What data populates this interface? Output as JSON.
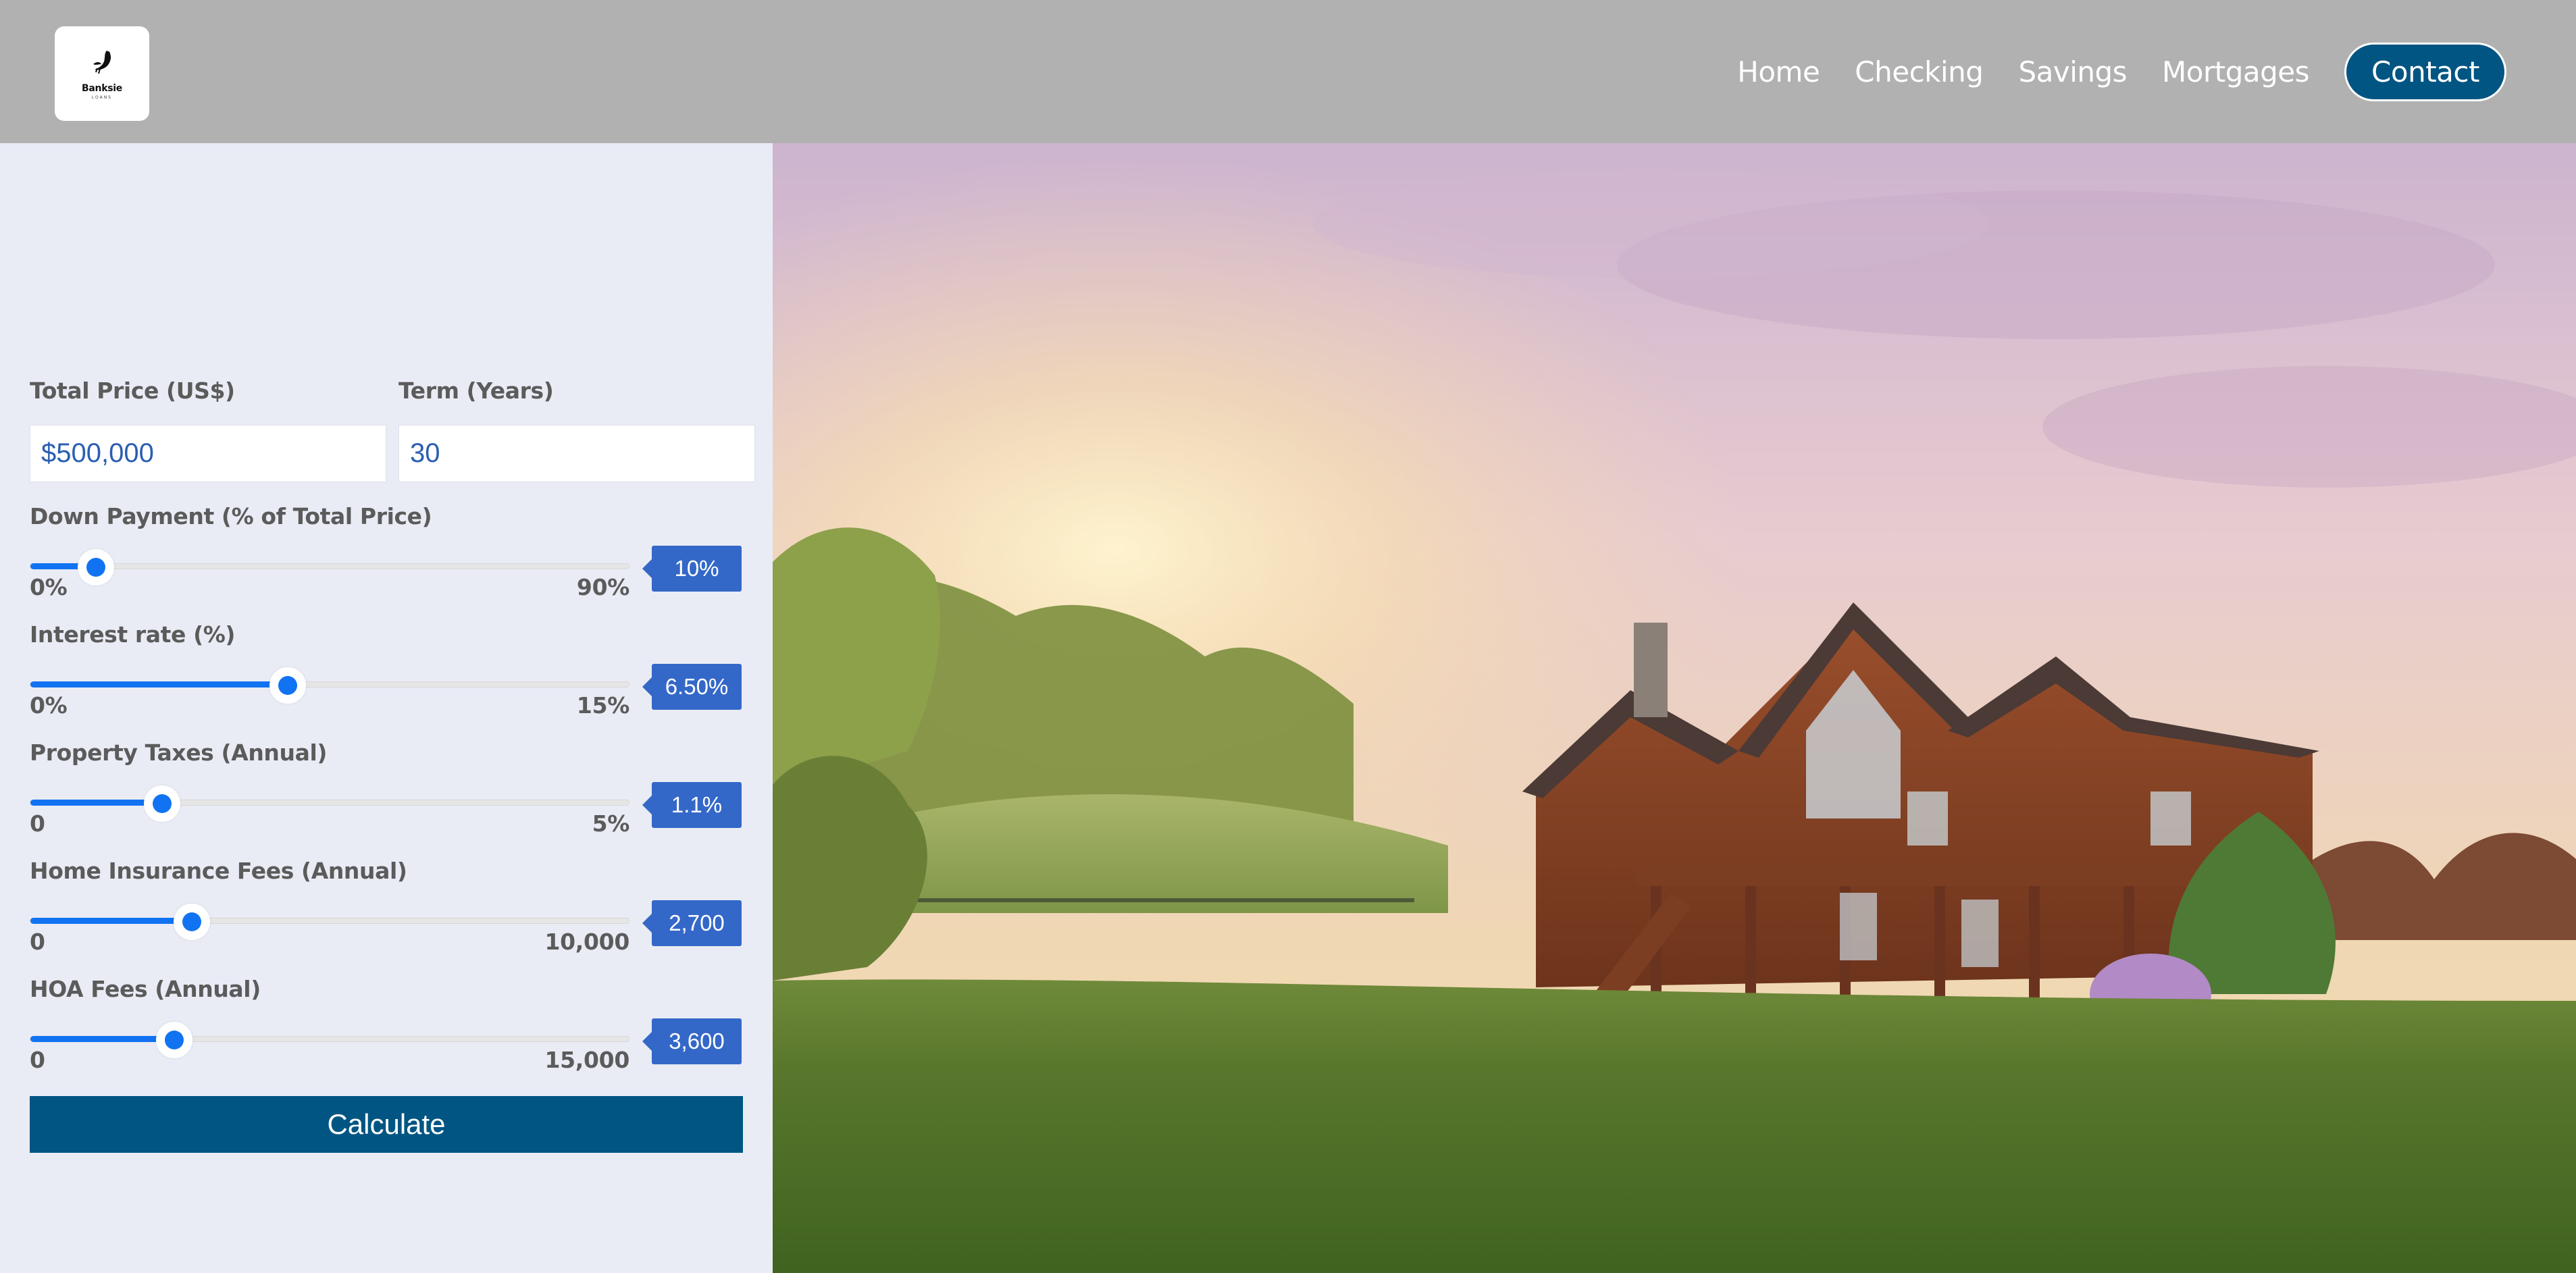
{
  "brand": {
    "name": "Banksie",
    "tagline": "LOANS"
  },
  "nav": {
    "items": [
      "Home",
      "Checking",
      "Savings",
      "Mortgages"
    ],
    "contact_label": "Contact"
  },
  "calculator": {
    "total_price": {
      "label": "Total Price (US$)",
      "value": "$500,000"
    },
    "term": {
      "label": "Term (Years)",
      "value": "30"
    },
    "sliders": [
      {
        "label": "Down Payment (% of Total Price)",
        "min": "0%",
        "max": "90%",
        "value": "10%",
        "level": 0.11
      },
      {
        "label": "Interest rate (%)",
        "min": "0%",
        "max": "15%",
        "value": "6.50%",
        "level": 0.43
      },
      {
        "label": "Property Taxes (Annual)",
        "min": "0",
        "max": "5%",
        "value": "1.1%",
        "level": 0.22
      },
      {
        "label": "Home Insurance Fees (Annual)",
        "min": "0",
        "max": "10,000",
        "value": "2,700",
        "level": 0.27
      },
      {
        "label": "HOA Fees (Annual)",
        "min": "0",
        "max": "15,000",
        "value": "3,600",
        "level": 0.24
      }
    ],
    "calculate_label": "Calculate"
  },
  "colors": {
    "header_bg": "#b1b1b1",
    "accent": "#005582",
    "slider": "#1173f1",
    "tooltip": "#3468c8",
    "panel_bg": "#e9ecf5"
  }
}
